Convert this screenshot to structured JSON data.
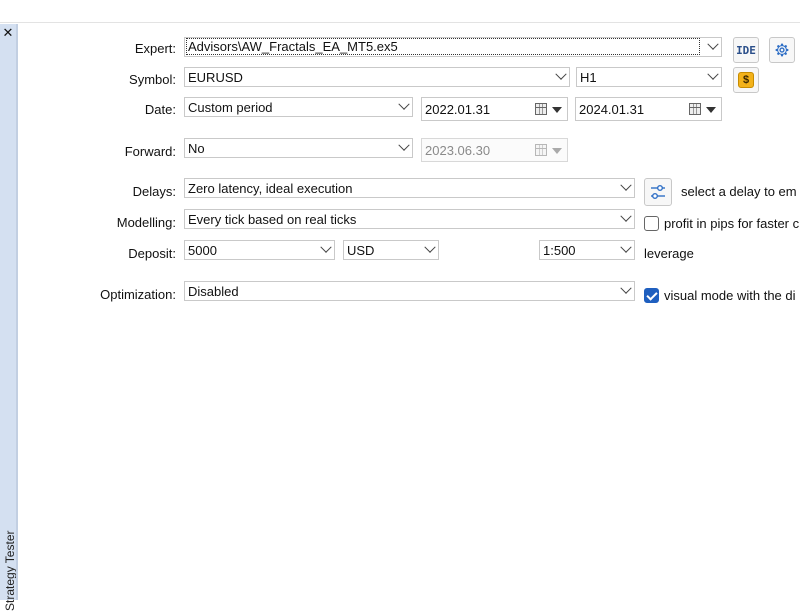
{
  "window": {
    "close_glyph": "✕",
    "side_tab": "Strategy Tester"
  },
  "labels": {
    "expert": "Expert:",
    "symbol": "Symbol:",
    "date": "Date:",
    "forward": "Forward:",
    "delays": "Delays:",
    "modelling": "Modelling:",
    "deposit": "Deposit:",
    "optimization": "Optimization:"
  },
  "fields": {
    "expert": "Advisors\\AW_Fractals_EA_MT5.ex5",
    "symbol": "EURUSD",
    "timeframe": "H1",
    "date_mode": "Custom period",
    "date_from": "2022.01.31",
    "date_to": "2024.01.31",
    "forward": "No",
    "forward_date": "2023.06.30",
    "delays": "Zero latency, ideal execution",
    "modelling": "Every tick based on real ticks",
    "deposit": "5000",
    "currency": "USD",
    "leverage": "1:500",
    "optimization": "Disabled"
  },
  "buttons": {
    "ide": "IDE",
    "dollar": "$"
  },
  "side_texts": {
    "delay_hint": "select a delay to em",
    "profit_pips": "profit in pips for faster c",
    "leverage": "leverage",
    "visual_mode": "visual mode with the di"
  },
  "checkboxes": {
    "profit_pips": false,
    "visual_mode": true
  },
  "colors": {
    "side_panel": "#d4e0f1",
    "checkbox_accent": "#1f5fbf",
    "dollar_icon": "#f3b21a"
  }
}
